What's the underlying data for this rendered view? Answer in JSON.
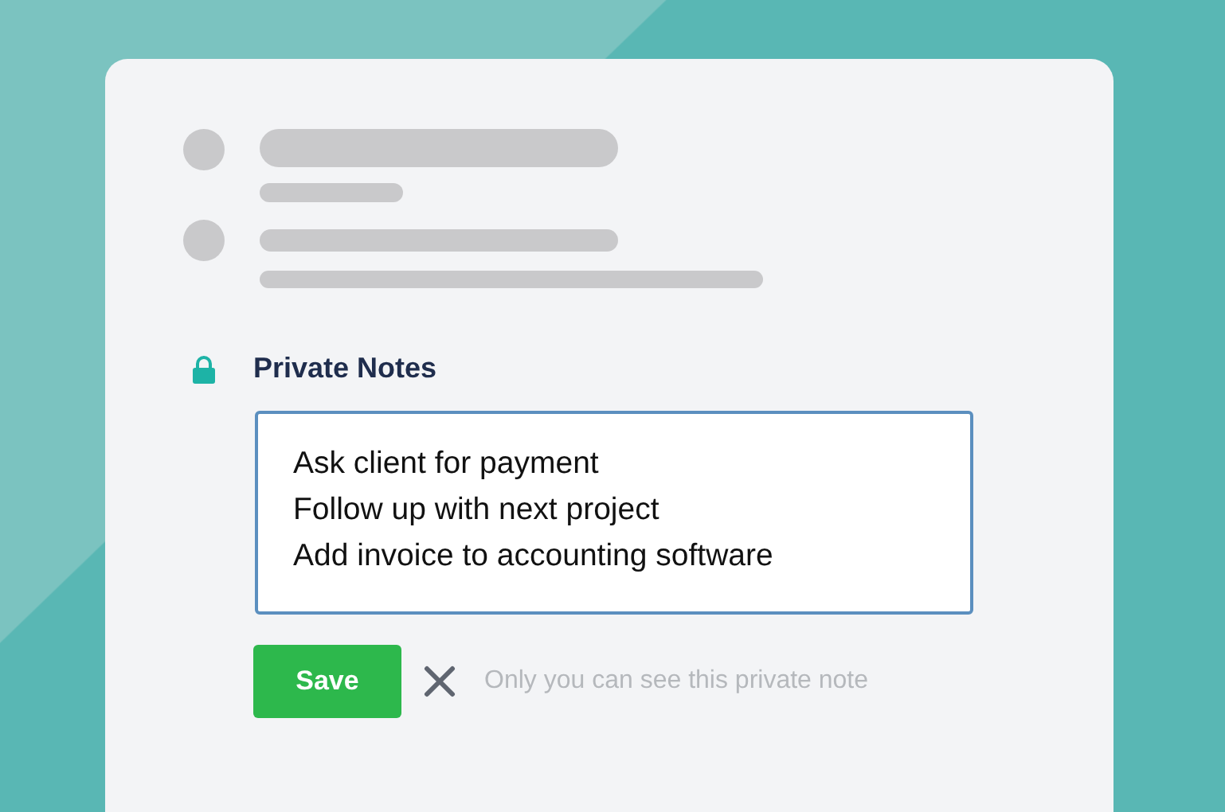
{
  "notes": {
    "title": "Private Notes",
    "lines": [
      "Ask client for payment",
      "Follow up with next project",
      "Add invoice to accounting software"
    ]
  },
  "actions": {
    "save": "Save",
    "hint": "Only you can see this private note"
  }
}
